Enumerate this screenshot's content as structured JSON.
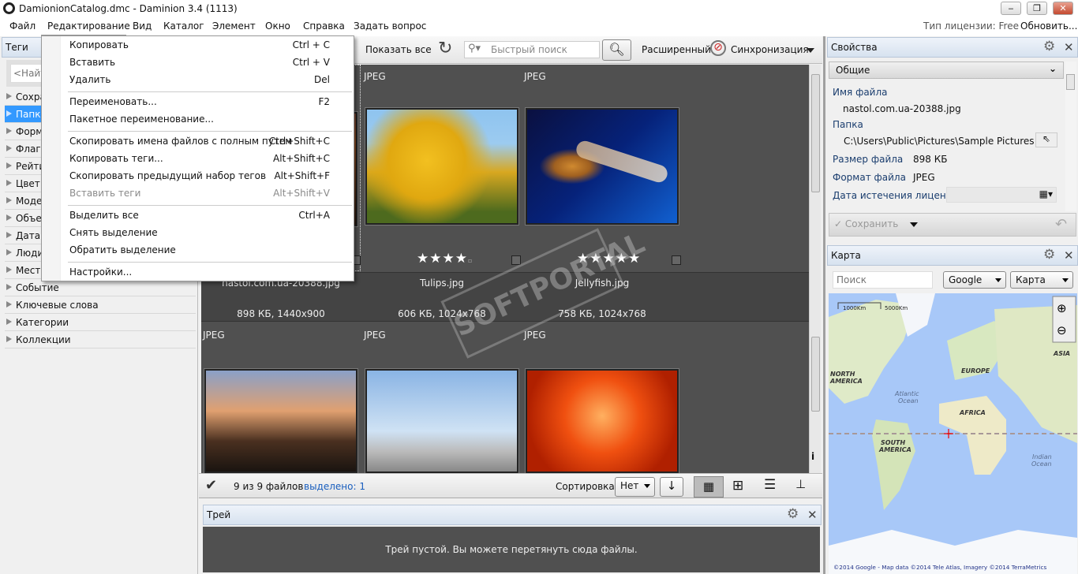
{
  "window": {
    "title": "DamionionCatalog.dmc - Daminion 3.4 (1113)",
    "minimize": "‒",
    "maximize": "❐",
    "close": "✕"
  },
  "menubar": {
    "items": [
      "Файл",
      "Редактирование",
      "Вид",
      "Каталог",
      "Элемент",
      "Окно",
      "Справка",
      "Задать вопрос"
    ],
    "license": "Тип лицензии: Free",
    "update": "Обновить..."
  },
  "edit_menu": {
    "items": [
      {
        "label": "Копировать",
        "shortcut": "Ctrl + C"
      },
      {
        "label": "Вставить",
        "shortcut": "Ctrl + V"
      },
      {
        "label": "Удалить",
        "shortcut": "Del"
      },
      {
        "label": "Переименовать...",
        "shortcut": "F2"
      },
      {
        "label": "Пакетное переименование...",
        "shortcut": ""
      },
      {
        "label": "Скопировать имена файлов с полным путем",
        "shortcut": "Ctrl+Shift+C"
      },
      {
        "label": "Копировать теги...",
        "shortcut": "Alt+Shift+C"
      },
      {
        "label": "Скопировать предыдущий набор тегов",
        "shortcut": "Alt+Shift+F"
      },
      {
        "label": "Вставить теги",
        "shortcut": "Alt+Shift+V",
        "disabled": true
      },
      {
        "label": "Выделить все",
        "shortcut": "Ctrl+A"
      },
      {
        "label": "Снять выделение",
        "shortcut": ""
      },
      {
        "label": "Обратить выделение",
        "shortcut": ""
      },
      {
        "label": "Настройки...",
        "shortcut": ""
      }
    ]
  },
  "tags_panel": {
    "title": "Теги",
    "search_placeholder": "<Найт",
    "items": [
      "Сохра",
      "Папк",
      "Форм",
      "Флаг",
      "Рейти",
      "Цвет",
      "Моде",
      "Объе",
      "Дата",
      "Люди",
      "Мест",
      "Событие",
      "Ключевые слова",
      "Категории",
      "Коллекции"
    ],
    "selected_index": 1
  },
  "toolbar": {
    "show_all": "Показать все",
    "search_placeholder": "Быстрый поиск",
    "advanced": "Расширенный",
    "sync": "Синхронизация"
  },
  "grid": {
    "row1": [
      {
        "format": "JPEG",
        "name": "nastol.com.ua-20388.jpg",
        "info": "898 КБ, 1440x900",
        "rating": 0,
        "selected": true
      },
      {
        "format": "JPEG",
        "name": "Tulips.jpg",
        "info": "606 КБ, 1024x768",
        "rating": 4
      },
      {
        "format": "JPEG",
        "name": "Jellyfish.jpg",
        "info": "758 КБ, 1024x768",
        "rating": 5
      }
    ],
    "row2": [
      {
        "format": "JPEG"
      },
      {
        "format": "JPEG"
      },
      {
        "format": "JPEG"
      }
    ],
    "star": "★",
    "empty_star": "▫"
  },
  "statusbar": {
    "count": "9 из 9 файлов",
    "selected": "выделено: 1",
    "sort_label": "Сортировка:",
    "sort_value": "Нет"
  },
  "tray": {
    "title": "Трей",
    "empty": "Трей пустой. Вы можете перетянуть сюда файлы."
  },
  "properties": {
    "title": "Свойства",
    "section": "Общие",
    "file_name_label": "Имя файла",
    "file_name": "nastol.com.ua-20388.jpg",
    "folder_label": "Папка",
    "folder": "C:\\Users\\Public\\Pictures\\Sample Pictures",
    "size_label": "Размер файла",
    "size": "898 КБ",
    "format_label": "Формат файла",
    "format": "JPEG",
    "license_date_label": "Дата истечения лицензии",
    "save": "Сохранить"
  },
  "map": {
    "title": "Карта",
    "search_placeholder": "Поиск",
    "provider": "Google",
    "type": "Карта",
    "scale1": "1000Km",
    "scale2": "5000Km",
    "labels": {
      "na1": "NORTH",
      "na2": "AMERICA",
      "eu": "EUROPE",
      "asia": "ASIA",
      "af": "AFRICA",
      "sa1": "SOUTH",
      "sa2": "AMERICA",
      "atl1": "Atlantic",
      "atl2": "Ocean",
      "ind1": "Indian",
      "ind2": "Ocean"
    },
    "attribution": "©2014 Google - Map data ©2014 Tele Atlas, Imagery ©2014 TerraMetrics"
  },
  "colors": {
    "accent": "#3399ff",
    "grid_bg": "#505050",
    "link": "#1a5fbf"
  }
}
